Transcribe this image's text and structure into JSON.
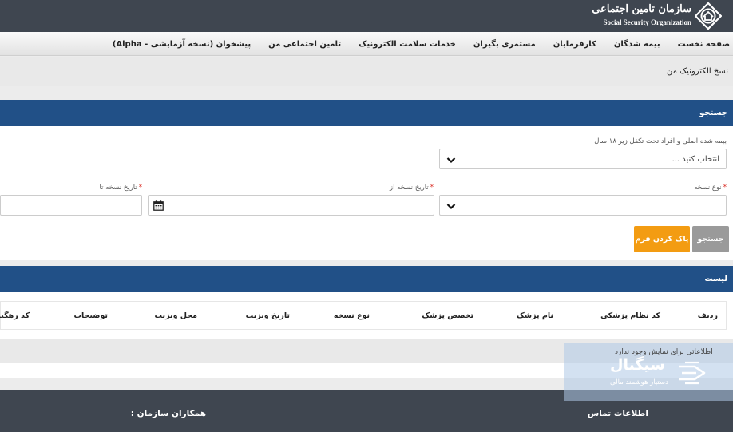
{
  "header": {
    "logo_fa": "سازمان تامین اجتماعی",
    "logo_en": "Social Security Organization"
  },
  "nav": [
    "صفحه نخست",
    "بیمه شدگان",
    "کارفرمایان",
    "مستمری بگیران",
    "خدمات سلامت الکترونیک",
    "تامین اجتماعی من",
    "پیشخوان (نسخه آزمایشی - Alpha)"
  ],
  "breadcrumb": "نسخ الکترونیک من",
  "search_panel": {
    "title": "جستجو",
    "insured_label": "بیمه شده اصلی و افراد تحت تکفل زیر ۱۸ سال",
    "insured_placeholder": "انتخاب کنید ...",
    "rx_type_label": "نوع نسخه",
    "date_from_label": "تاریخ نسخه از",
    "date_to_label": "تاریخ نسخه تا",
    "required_mark": "*",
    "search_button": "جستجو",
    "clear_button": "پاک کردن فرم"
  },
  "list_panel": {
    "title": "لیست",
    "columns": [
      "ردیف",
      "کد نظام پزشکی",
      "نام پزشک",
      "تخصص پزشک",
      "نوع نسخه",
      "تاریخ ویزیت",
      "محل ویزیت",
      "توضیحات",
      "کد رهگیری"
    ],
    "empty_message": "اطلاعاتی برای نمایش وجود ندارد"
  },
  "footer": {
    "contact": "اطلاعات تماس",
    "partners": "همکاران سازمان :"
  },
  "overlay": {
    "title": "سیگنال",
    "subtitle": "دستیار هوشمند مالی"
  },
  "colors": {
    "topbar": "#3f4650",
    "panel_header": "#215087",
    "clear_button": "#f39c12",
    "search_button": "#9a9a9a",
    "required": "#d9251d"
  }
}
